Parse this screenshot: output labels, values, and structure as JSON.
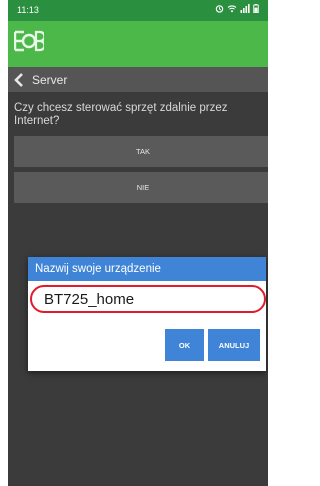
{
  "status_bar": {
    "time": "11:13",
    "icons": [
      "alarm-icon",
      "wifi-icon",
      "signal-icon",
      "battery-icon"
    ]
  },
  "header": {
    "logo": "EOB logo",
    "color": "#4cb84a"
  },
  "nav": {
    "back_icon": "chevron-left-icon",
    "title": "Server"
  },
  "main": {
    "question": "Czy chcesz sterować sprzęt zdalnie przez Internet?",
    "yes_label": "TAK",
    "no_label": "NIE"
  },
  "dialog": {
    "title": "Nazwij swoje urządzenie",
    "input_value": "BT725_home",
    "ok_label": "OK",
    "cancel_label": "ANULUJ",
    "highlight_color": "#e01b2a",
    "accent_color": "#3f84d6"
  }
}
